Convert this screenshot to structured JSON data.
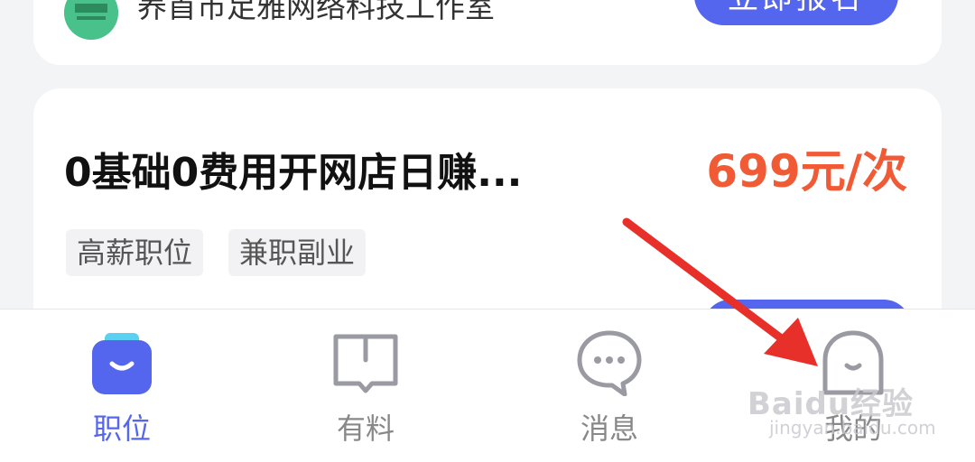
{
  "company_card": {
    "name": "养首市足雅网络科技工作室",
    "button_label": "立即报名"
  },
  "job_card": {
    "title": "0基础0费用开网店日赚...",
    "salary": "699元/次",
    "tags": [
      "高薪职位",
      "兼职副业"
    ]
  },
  "tabbar": {
    "tabs": [
      {
        "label": "职位",
        "icon": "briefcase-icon",
        "active": true
      },
      {
        "label": "有料",
        "icon": "book-icon",
        "active": false
      },
      {
        "label": "消息",
        "icon": "chat-bubble-icon",
        "active": false
      },
      {
        "label": "我的",
        "icon": "profile-face-icon",
        "active": false
      }
    ]
  },
  "overlay": {
    "watermark": "Baidu经验",
    "watermark_url": "jingyan.baidu.com",
    "arrow_color": "#e8302a"
  },
  "colors": {
    "accent": "#5566ee",
    "salary": "#f05a35",
    "background": "#f3f4f6"
  }
}
